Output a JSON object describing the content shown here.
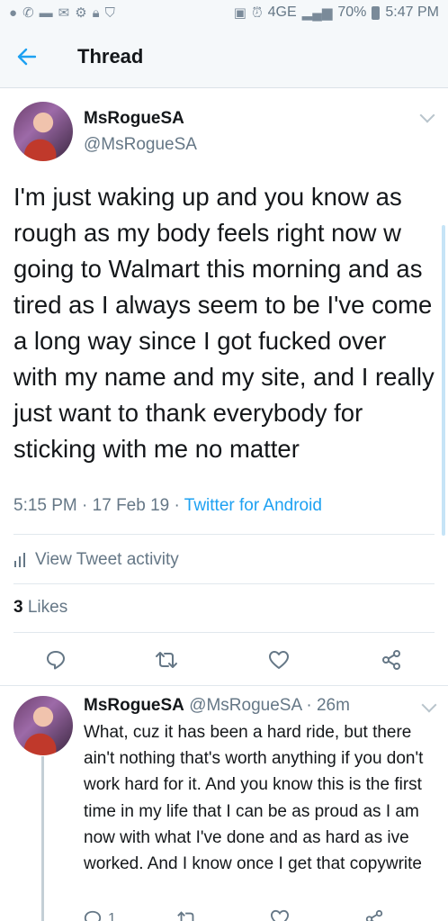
{
  "status_bar": {
    "battery": "70%",
    "time": "5:47 PM",
    "network": "4GE",
    "icons": [
      "chat-icon",
      "missed-call-icon",
      "voicemail-icon",
      "mail-icon",
      "settings-icon",
      "lock-icon",
      "shield-icon",
      "cast-icon",
      "alarm-icon",
      "signal-icon",
      "battery-icon"
    ]
  },
  "header": {
    "title": "Thread",
    "back_icon": "back-arrow-icon"
  },
  "tweet": {
    "name": "MsRogueSA",
    "handle": "@MsRogueSA",
    "text": "I'm just waking up and you know as rough as my body feels right now w going to Walmart this morning and as tired as I always seem to be I've come a long way since I got fucked over with my name and my site, and I really just want to thank everybody for sticking with me no matter",
    "time": "5:15 PM",
    "date": "17 Feb 19",
    "source": "Twitter for Android",
    "activity_label": "View Tweet activity",
    "likes_count": "3",
    "likes_label": "Likes"
  },
  "reply": {
    "name": "MsRogueSA",
    "handle": "@MsRogueSA",
    "age": "26m",
    "text": "What, cuz it has been a hard ride, but there ain't nothing that's worth anything if you don't work hard for it. And you know this is the first time in my life that I can be as proud as I am now with what I've done and as hard as ive worked. And I know once I get that copywrite",
    "reply_count": "1"
  },
  "colors": {
    "accent": "#1da1f2",
    "secondary_text": "#657786",
    "primary_text": "#14171a",
    "header_bg": "#f5f8fa"
  }
}
